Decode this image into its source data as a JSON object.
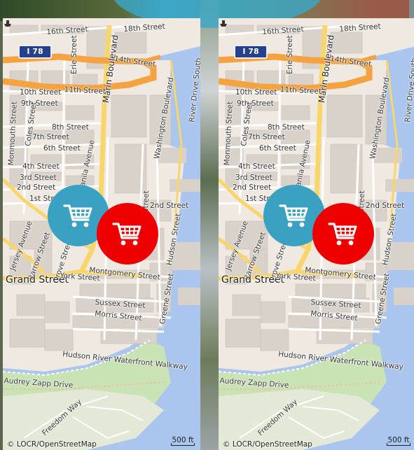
{
  "map": {
    "highway_shield": "I 78",
    "labels": [
      {
        "id": "16th",
        "text": "16th Street"
      },
      {
        "id": "18th",
        "text": "18th Street"
      },
      {
        "id": "14th",
        "text": "14th Street"
      },
      {
        "id": "erie",
        "text": "Erie Street"
      },
      {
        "id": "marin",
        "text": "Marin Boulevard"
      },
      {
        "id": "11th",
        "text": "11th Street"
      },
      {
        "id": "10th",
        "text": "10th Street"
      },
      {
        "id": "9th",
        "text": "9th Street"
      },
      {
        "id": "monmouth",
        "text": "Monmouth Street"
      },
      {
        "id": "coles",
        "text": "Coles Street"
      },
      {
        "id": "8th",
        "text": "8th Street"
      },
      {
        "id": "7th",
        "text": "7th Street"
      },
      {
        "id": "6th",
        "text": "6th Street"
      },
      {
        "id": "manila",
        "text": "Manila Avenue"
      },
      {
        "id": "4th",
        "text": "4th Street"
      },
      {
        "id": "3rd",
        "text": "3rd Street"
      },
      {
        "id": "2nd",
        "text": "2nd Street"
      },
      {
        "id": "1st",
        "text": "1st Street"
      },
      {
        "id": "2nd_e",
        "text": "2nd Street"
      },
      {
        "id": "washington",
        "text": "Washington Boulevard"
      },
      {
        "id": "riverdrive",
        "text": "River Drive South"
      },
      {
        "id": "street_v",
        "text": "Street"
      },
      {
        "id": "hudson",
        "text": "Hudson Street"
      },
      {
        "id": "jersey",
        "text": "Jersey Avenue"
      },
      {
        "id": "barrow",
        "text": "Barrow Street"
      },
      {
        "id": "grove",
        "text": "Grove Street"
      },
      {
        "id": "grand",
        "text": "Grand Street"
      },
      {
        "id": "york",
        "text": "York Street"
      },
      {
        "id": "montgomery",
        "text": "Montgomery Street"
      },
      {
        "id": "sussex",
        "text": "Sussex Street"
      },
      {
        "id": "morris",
        "text": "Morris Street"
      },
      {
        "id": "greene",
        "text": "Greene Street"
      },
      {
        "id": "hudsonriver",
        "text": "Hudson River Waterfront Walkway"
      },
      {
        "id": "audrey",
        "text": "Audrey Zapp Drive"
      },
      {
        "id": "freedom",
        "text": "Freedom Way"
      }
    ],
    "attribution": "© LOCR/OpenStreetMap",
    "scale_label": "500 ft",
    "colors": {
      "land": "#efe9e1",
      "water": "#aac6ee",
      "highway": "#f4a340",
      "major_road": "#f9d66b",
      "park": "#c9e3b5",
      "blue_marker": "#3aa1c3",
      "red_marker": "#ee0000"
    }
  },
  "markers": [
    {
      "id": "cart-blue",
      "icon": "shopping-cart-icon",
      "color": "#3aa1c3"
    },
    {
      "id": "cart-red",
      "icon": "shopping-cart-icon",
      "color": "#ee0000"
    }
  ]
}
